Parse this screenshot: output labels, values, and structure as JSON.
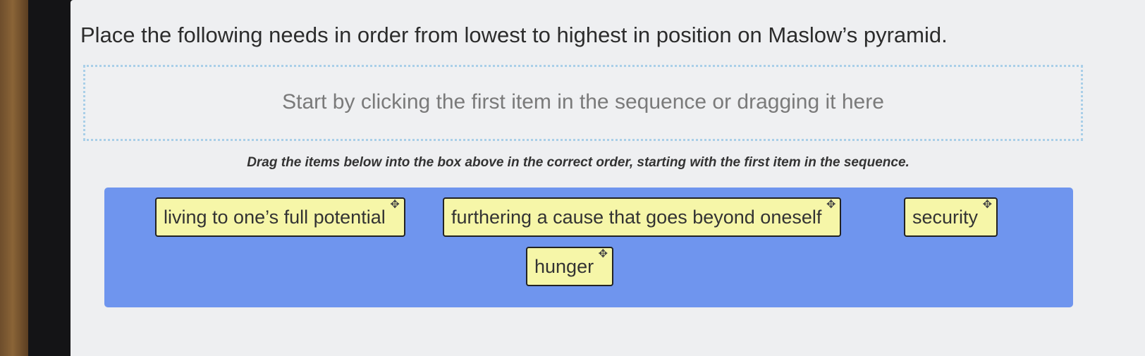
{
  "question": "Place the following needs in order from lowest to highest in position on Maslow’s pyramid.",
  "dropzone": {
    "placeholder": "Start by clicking the first item in the sequence or dragging it here"
  },
  "instructions": "Drag the items below into the box above in the correct order, starting with the first item in the sequence.",
  "items": [
    {
      "label": "living to one’s full potential"
    },
    {
      "label": "furthering a cause that goes beyond oneself"
    },
    {
      "label": "security"
    },
    {
      "label": "hunger"
    }
  ],
  "icons": {
    "move": "move-handle-icon"
  },
  "colors": {
    "palette_background": "#6f95ee",
    "item_background": "#f6f6a8",
    "dropzone_border": "#a9cfe8"
  }
}
